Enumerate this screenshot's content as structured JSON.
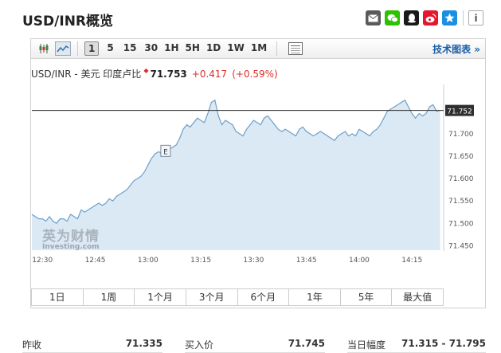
{
  "header": {
    "title": "USD/INR概览"
  },
  "share_icons": [
    "mail-icon",
    "wechat-icon",
    "qq-icon",
    "weibo-icon",
    "qzone-icon"
  ],
  "toolbar": {
    "timeframes": [
      "1",
      "5",
      "15",
      "30",
      "1H",
      "5H",
      "1D",
      "1W",
      "1M"
    ],
    "active_timeframe": "1",
    "tech_chart_link": "技术图表 »"
  },
  "quote": {
    "name": "USD/INR - 美元 印度卢比",
    "price": "71.753",
    "change": "+0.417",
    "change_pct": "(+0.59%)"
  },
  "watermark": {
    "brand_cn": "英为财情",
    "brand_en": "Investing.com"
  },
  "event_marker": "E",
  "current_price_label": "71.752",
  "ranges": [
    "1日",
    "1周",
    "1个月",
    "3个月",
    "6个月",
    "1年",
    "5年",
    "最大值"
  ],
  "stats": [
    {
      "label": "昨收",
      "value": "71.335"
    },
    {
      "label": "买入价",
      "value": "71.745"
    },
    {
      "label": "当日幅度",
      "value": "71.315 - 71.795"
    }
  ],
  "colors": {
    "line": "#6b9fc9",
    "area": "#dbe9f5",
    "up": "#d9302c",
    "link": "#1a5ea8"
  },
  "chart_data": {
    "type": "area",
    "ylim": [
      71.44,
      71.81
    ],
    "y_ticks": [
      "71.700",
      "71.650",
      "71.600",
      "71.550",
      "71.500",
      "71.450"
    ],
    "x_ticks": [
      "12:30",
      "12:45",
      "13:00",
      "13:15",
      "13:30",
      "13:45",
      "14:00",
      "14:15"
    ],
    "x_range_minutes": [
      0,
      117
    ],
    "current_value": 71.752,
    "marker_minute": 38,
    "points": [
      [
        0,
        71.52
      ],
      [
        1,
        71.515
      ],
      [
        2,
        71.51
      ],
      [
        3,
        71.51
      ],
      [
        4,
        71.505
      ],
      [
        5,
        71.515
      ],
      [
        6,
        71.505
      ],
      [
        7,
        71.5
      ],
      [
        8,
        71.51
      ],
      [
        9,
        71.51
      ],
      [
        10,
        71.505
      ],
      [
        11,
        71.52
      ],
      [
        12,
        71.515
      ],
      [
        13,
        71.51
      ],
      [
        14,
        71.53
      ],
      [
        15,
        71.525
      ],
      [
        16,
        71.53
      ],
      [
        17,
        71.535
      ],
      [
        18,
        71.54
      ],
      [
        19,
        71.545
      ],
      [
        20,
        71.54
      ],
      [
        21,
        71.545
      ],
      [
        22,
        71.555
      ],
      [
        23,
        71.55
      ],
      [
        24,
        71.56
      ],
      [
        25,
        71.565
      ],
      [
        26,
        71.57
      ],
      [
        27,
        71.575
      ],
      [
        28,
        71.585
      ],
      [
        29,
        71.595
      ],
      [
        30,
        71.6
      ],
      [
        31,
        71.605
      ],
      [
        32,
        71.615
      ],
      [
        33,
        71.63
      ],
      [
        34,
        71.645
      ],
      [
        35,
        71.655
      ],
      [
        36,
        71.66
      ],
      [
        37,
        71.655
      ],
      [
        38,
        71.66
      ],
      [
        39,
        71.665
      ],
      [
        40,
        71.67
      ],
      [
        41,
        71.675
      ],
      [
        42,
        71.69
      ],
      [
        43,
        71.71
      ],
      [
        44,
        71.72
      ],
      [
        45,
        71.715
      ],
      [
        46,
        71.725
      ],
      [
        47,
        71.735
      ],
      [
        48,
        71.73
      ],
      [
        49,
        71.725
      ],
      [
        50,
        71.745
      ],
      [
        51,
        71.77
      ],
      [
        52,
        71.775
      ],
      [
        53,
        71.74
      ],
      [
        54,
        71.72
      ],
      [
        55,
        71.73
      ],
      [
        56,
        71.725
      ],
      [
        57,
        71.72
      ],
      [
        58,
        71.705
      ],
      [
        59,
        71.7
      ],
      [
        60,
        71.695
      ],
      [
        61,
        71.71
      ],
      [
        62,
        71.72
      ],
      [
        63,
        71.73
      ],
      [
        64,
        71.725
      ],
      [
        65,
        71.72
      ],
      [
        66,
        71.735
      ],
      [
        67,
        71.74
      ],
      [
        68,
        71.73
      ],
      [
        69,
        71.72
      ],
      [
        70,
        71.71
      ],
      [
        71,
        71.705
      ],
      [
        72,
        71.71
      ],
      [
        73,
        71.705
      ],
      [
        74,
        71.7
      ],
      [
        75,
        71.695
      ],
      [
        76,
        71.71
      ],
      [
        77,
        71.715
      ],
      [
        78,
        71.705
      ],
      [
        79,
        71.7
      ],
      [
        80,
        71.695
      ],
      [
        81,
        71.7
      ],
      [
        82,
        71.705
      ],
      [
        83,
        71.7
      ],
      [
        84,
        71.695
      ],
      [
        85,
        71.69
      ],
      [
        86,
        71.685
      ],
      [
        87,
        71.695
      ],
      [
        88,
        71.7
      ],
      [
        89,
        71.705
      ],
      [
        90,
        71.695
      ],
      [
        91,
        71.7
      ],
      [
        92,
        71.695
      ],
      [
        93,
        71.71
      ],
      [
        94,
        71.705
      ],
      [
        95,
        71.7
      ],
      [
        96,
        71.695
      ],
      [
        97,
        71.705
      ],
      [
        98,
        71.71
      ],
      [
        99,
        71.72
      ],
      [
        100,
        71.735
      ],
      [
        101,
        71.75
      ],
      [
        102,
        71.755
      ],
      [
        103,
        71.76
      ],
      [
        104,
        71.765
      ],
      [
        105,
        71.77
      ],
      [
        106,
        71.775
      ],
      [
        107,
        71.76
      ],
      [
        108,
        71.745
      ],
      [
        109,
        71.735
      ],
      [
        110,
        71.745
      ],
      [
        111,
        71.74
      ],
      [
        112,
        71.745
      ],
      [
        113,
        71.76
      ],
      [
        114,
        71.765
      ],
      [
        115,
        71.75
      ],
      [
        116,
        71.752
      ]
    ]
  }
}
